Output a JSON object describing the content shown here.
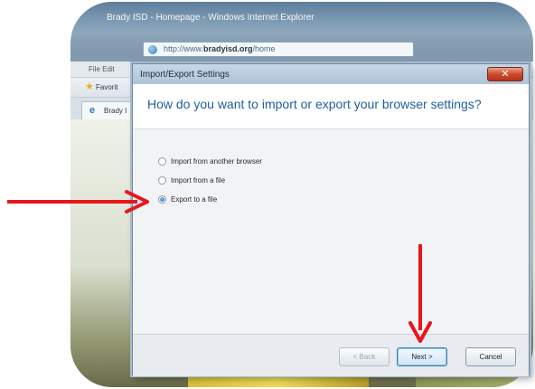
{
  "browser": {
    "window_title": "Brady ISD - Homepage - Windows Internet Explorer",
    "address": {
      "prefix": "http://www.",
      "host": "bradyisd.org",
      "suffix": "/home"
    },
    "menu_partial": "File  Edit",
    "favorites_label": "Favorit",
    "tab_label": "Brady I"
  },
  "dialog": {
    "title": "Import/Export Settings",
    "close_glyph": "✕",
    "question": "How do you want to import or export your browser settings?",
    "options": [
      {
        "label": "Import from another browser",
        "selected": false
      },
      {
        "label": "Import from a file",
        "selected": false
      },
      {
        "label": "Export to a file",
        "selected": true
      }
    ],
    "buttons": {
      "back": "< Back",
      "next": "Next >",
      "cancel": "Cancel"
    }
  },
  "annotations": {
    "arrow_color": "#e8151b",
    "arrow_targets": [
      "export-to-file-radio",
      "next-button"
    ]
  }
}
